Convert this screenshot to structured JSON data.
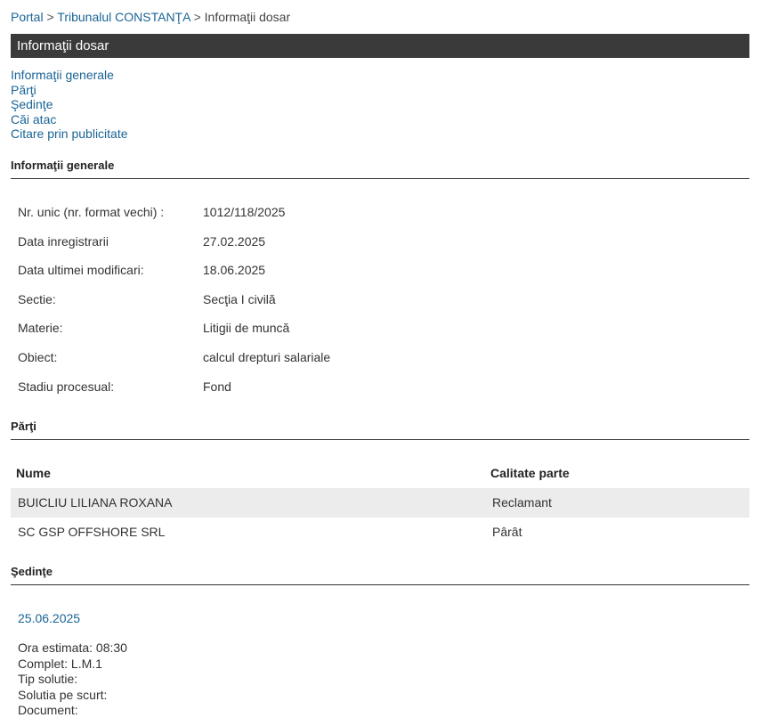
{
  "breadcrumb": {
    "portal": "Portal",
    "sep1": ">",
    "court": "Tribunalul CONSTANŢA",
    "sep2": ">",
    "current": "Informaţii dosar"
  },
  "page_title": "Informaţii dosar",
  "nav": {
    "items": [
      {
        "label": "Informaţii generale"
      },
      {
        "label": "Părţi"
      },
      {
        "label": "Şedinţe"
      },
      {
        "label": "Căi atac"
      },
      {
        "label": "Citare prin publicitate"
      }
    ]
  },
  "general": {
    "heading": "Informaţii generale",
    "rows": [
      {
        "label": "Nr. unic (nr. format vechi) :",
        "value": "1012/118/2025"
      },
      {
        "label": "Data inregistrarii",
        "value": "27.02.2025"
      },
      {
        "label": "Data ultimei modificari:",
        "value": "18.06.2025"
      },
      {
        "label": "Sectie:",
        "value": "Secţia I civilă"
      },
      {
        "label": "Materie:",
        "value": "Litigii de muncă"
      },
      {
        "label": "Obiect:",
        "value": "calcul drepturi salariale"
      },
      {
        "label": "Stadiu procesual:",
        "value": "Fond"
      }
    ]
  },
  "parties": {
    "heading": "Părţi",
    "columns": [
      "Nume",
      "Calitate parte"
    ],
    "rows": [
      {
        "name": "BUICLIU LILIANA ROXANA",
        "role": "Reclamant"
      },
      {
        "name": "SC GSP OFFSHORE SRL",
        "role": "Pârât"
      }
    ]
  },
  "hearings": {
    "heading": "Şedinţe",
    "date": "25.06.2025",
    "details": [
      "Ora estimata: 08:30",
      "Complet: L.M.1",
      "Tip solutie:",
      "Solutia pe scurt:",
      "Document:"
    ]
  }
}
